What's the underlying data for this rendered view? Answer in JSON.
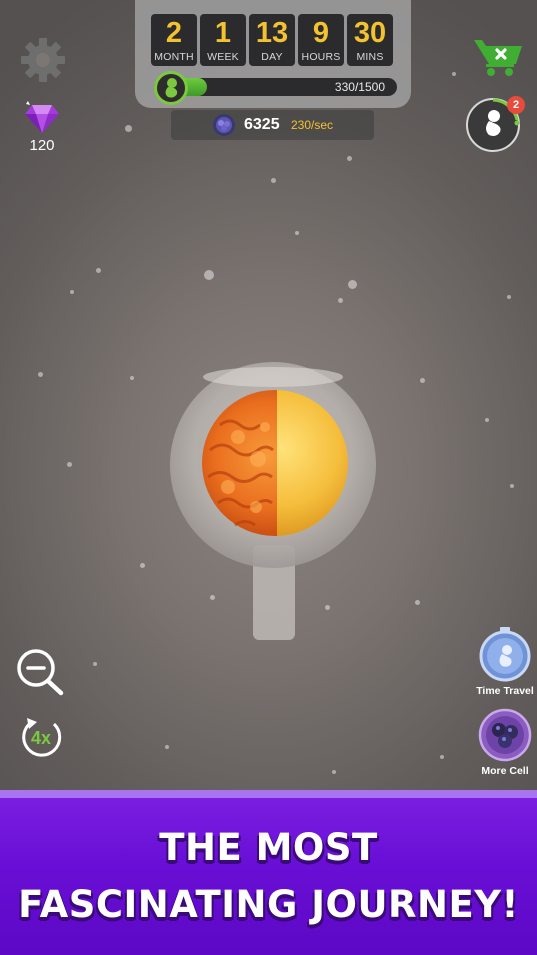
{
  "timer": {
    "units": [
      {
        "value": "2",
        "label": "MONTH"
      },
      {
        "value": "1",
        "label": "WEEK"
      },
      {
        "value": "13",
        "label": "DAY"
      },
      {
        "value": "9",
        "label": "HOURS"
      },
      {
        "value": "30",
        "label": "MINS"
      }
    ],
    "progress_text_current": "330",
    "progress_text_total": "1500",
    "progress_fraction": 0.22
  },
  "cells": {
    "count": "6325",
    "rate": "230/sec"
  },
  "gems": {
    "count": "120",
    "icon": "purple-gem-icon"
  },
  "notifications": {
    "evolution_badge": "2"
  },
  "side_buttons": {
    "time_travel_label": "Time Travel",
    "more_cell_label": "More Cell",
    "speed_label": "4x"
  },
  "banner": {
    "line1": "THE MOST",
    "line2": "FASCINATING JOURNEY!"
  },
  "colors": {
    "accent_yellow": "#f2c230",
    "progress_green": "#5bb534",
    "banner_purple": "#6a0fd6"
  }
}
